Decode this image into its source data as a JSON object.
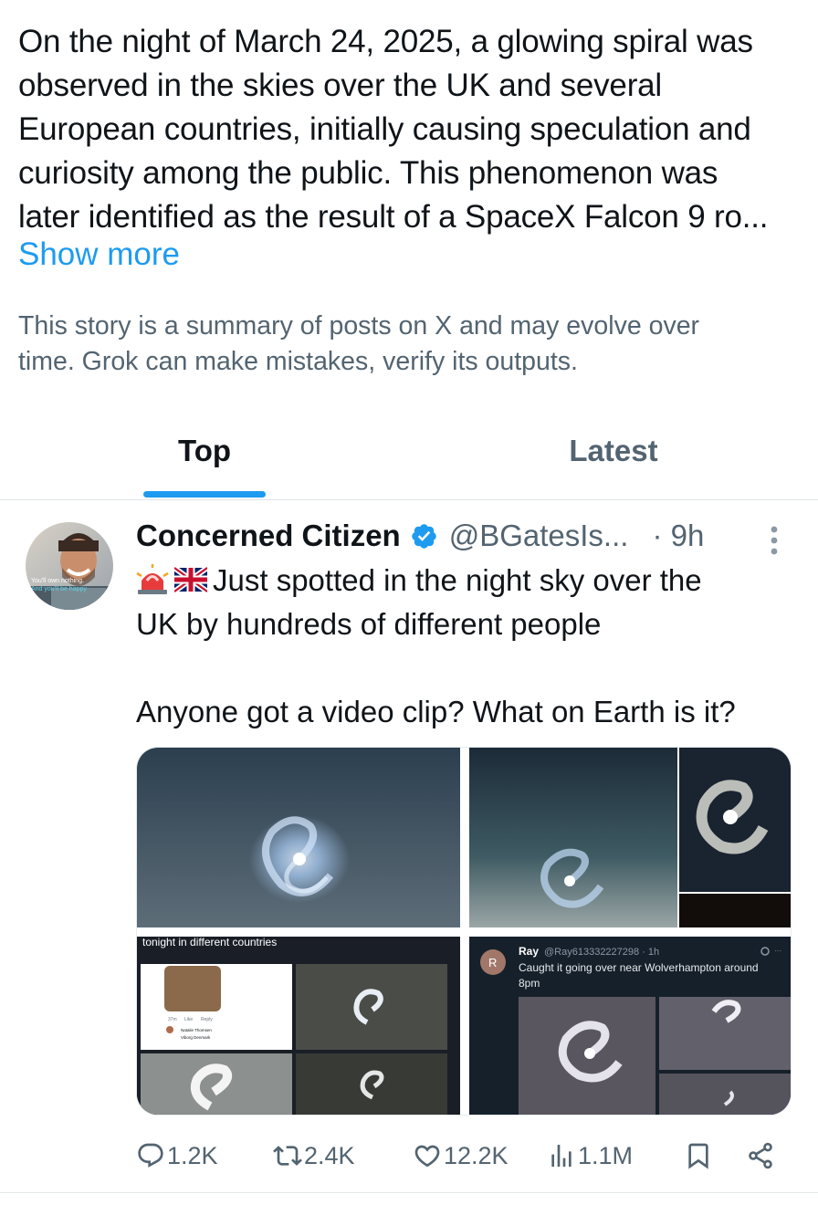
{
  "summary": {
    "lines": [
      "On the night of March 24, 2025, a glowing spiral was",
      "observed in the skies over the UK and several",
      "European countries, initially causing speculation and",
      "curiosity among the public. This phenomenon was",
      "later identified as the result of a SpaceX Falcon 9 ro..."
    ],
    "show_more": "Show more"
  },
  "disclaimer": {
    "lines": [
      "This story is a summary of posts on X and may evolve over",
      "time. Grok can make mistakes, verify its outputs."
    ]
  },
  "tabs": [
    {
      "label": "Top",
      "active": true
    },
    {
      "label": "Latest",
      "active": false
    }
  ],
  "post": {
    "author": {
      "name": "Concerned Citizen",
      "handle": "@BGatesIs...",
      "verified": true,
      "avatar_caption": {
        "line1": "You'll own nothing.",
        "line2": "And you'll be happy"
      }
    },
    "time": "· 9h",
    "text_lines": [
      "Just spotted in the night sky over the",
      "UK by hundreds of different people",
      "",
      "Anyone got a video clip?  What on Earth is it?"
    ],
    "emoji": [
      "siren-emoji",
      "uk-flag-emoji"
    ],
    "media": {
      "image3_caption": "tonight in different countries",
      "image3_comment": {
        "like": "Like",
        "reply": "Reply",
        "name": "Natalie Thomsen",
        "location": "Viborg Denmark"
      },
      "image4_reply": {
        "avatar_letter": "R",
        "name": "Ray",
        "handle_time": "@Ray613332227298 · 1h",
        "text_line1": "Caught it going over near Wolverhampton around",
        "text_line2": "8pm"
      }
    },
    "actions": {
      "replies": "1.2K",
      "reposts": "2.4K",
      "likes": "12.2K",
      "views": "1.1M"
    }
  },
  "colors": {
    "accent": "#1d9bf0",
    "text_primary": "#0f1419",
    "text_secondary": "#536471"
  }
}
